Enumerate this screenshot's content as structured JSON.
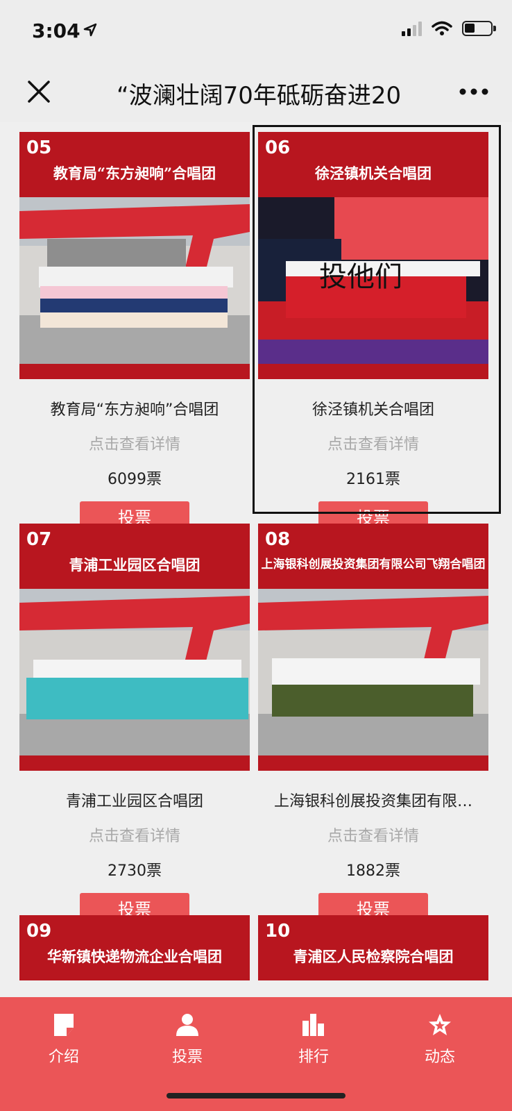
{
  "status": {
    "time": "3:04"
  },
  "nav": {
    "title": "“波澜壮阔70年砥砺奋进20"
  },
  "cards": [
    {
      "num": "05",
      "header_title": "教育局“东方昶响”合唱团",
      "name": "教育局“东方昶响”合唱团",
      "detail": "点击查看详情",
      "votes": "6099票",
      "vote_label": "投票"
    },
    {
      "num": "06",
      "header_title": "徐泾镇机关合唱团",
      "name": "徐泾镇机关合唱团",
      "detail": "点击查看详情",
      "votes": "2161票",
      "vote_label": "投票",
      "overlay": "投他们"
    },
    {
      "num": "07",
      "header_title": "青浦工业园区合唱团",
      "name": "青浦工业园区合唱团",
      "detail": "点击查看详情",
      "votes": "2730票",
      "vote_label": "投票"
    },
    {
      "num": "08",
      "header_title": "上海银科创展投资集团有限公司飞翔合唱团",
      "name": "上海银科创展投资集团有限…",
      "detail": "点击查看详情",
      "votes": "1882票",
      "vote_label": "投票"
    },
    {
      "num": "09",
      "header_title": "华新镇快递物流企业合唱团"
    },
    {
      "num": "10",
      "header_title": "青浦区人民检察院合唱团"
    }
  ],
  "tabs": [
    {
      "label": "介绍",
      "icon": "document-icon"
    },
    {
      "label": "投票",
      "icon": "person-icon"
    },
    {
      "label": "排行",
      "icon": "bar-chart-icon"
    },
    {
      "label": "动态",
      "icon": "star-icon"
    }
  ],
  "colors": {
    "header_red": "#b8161f",
    "button_red": "#eb5557",
    "tab_red": "#eb5557"
  }
}
